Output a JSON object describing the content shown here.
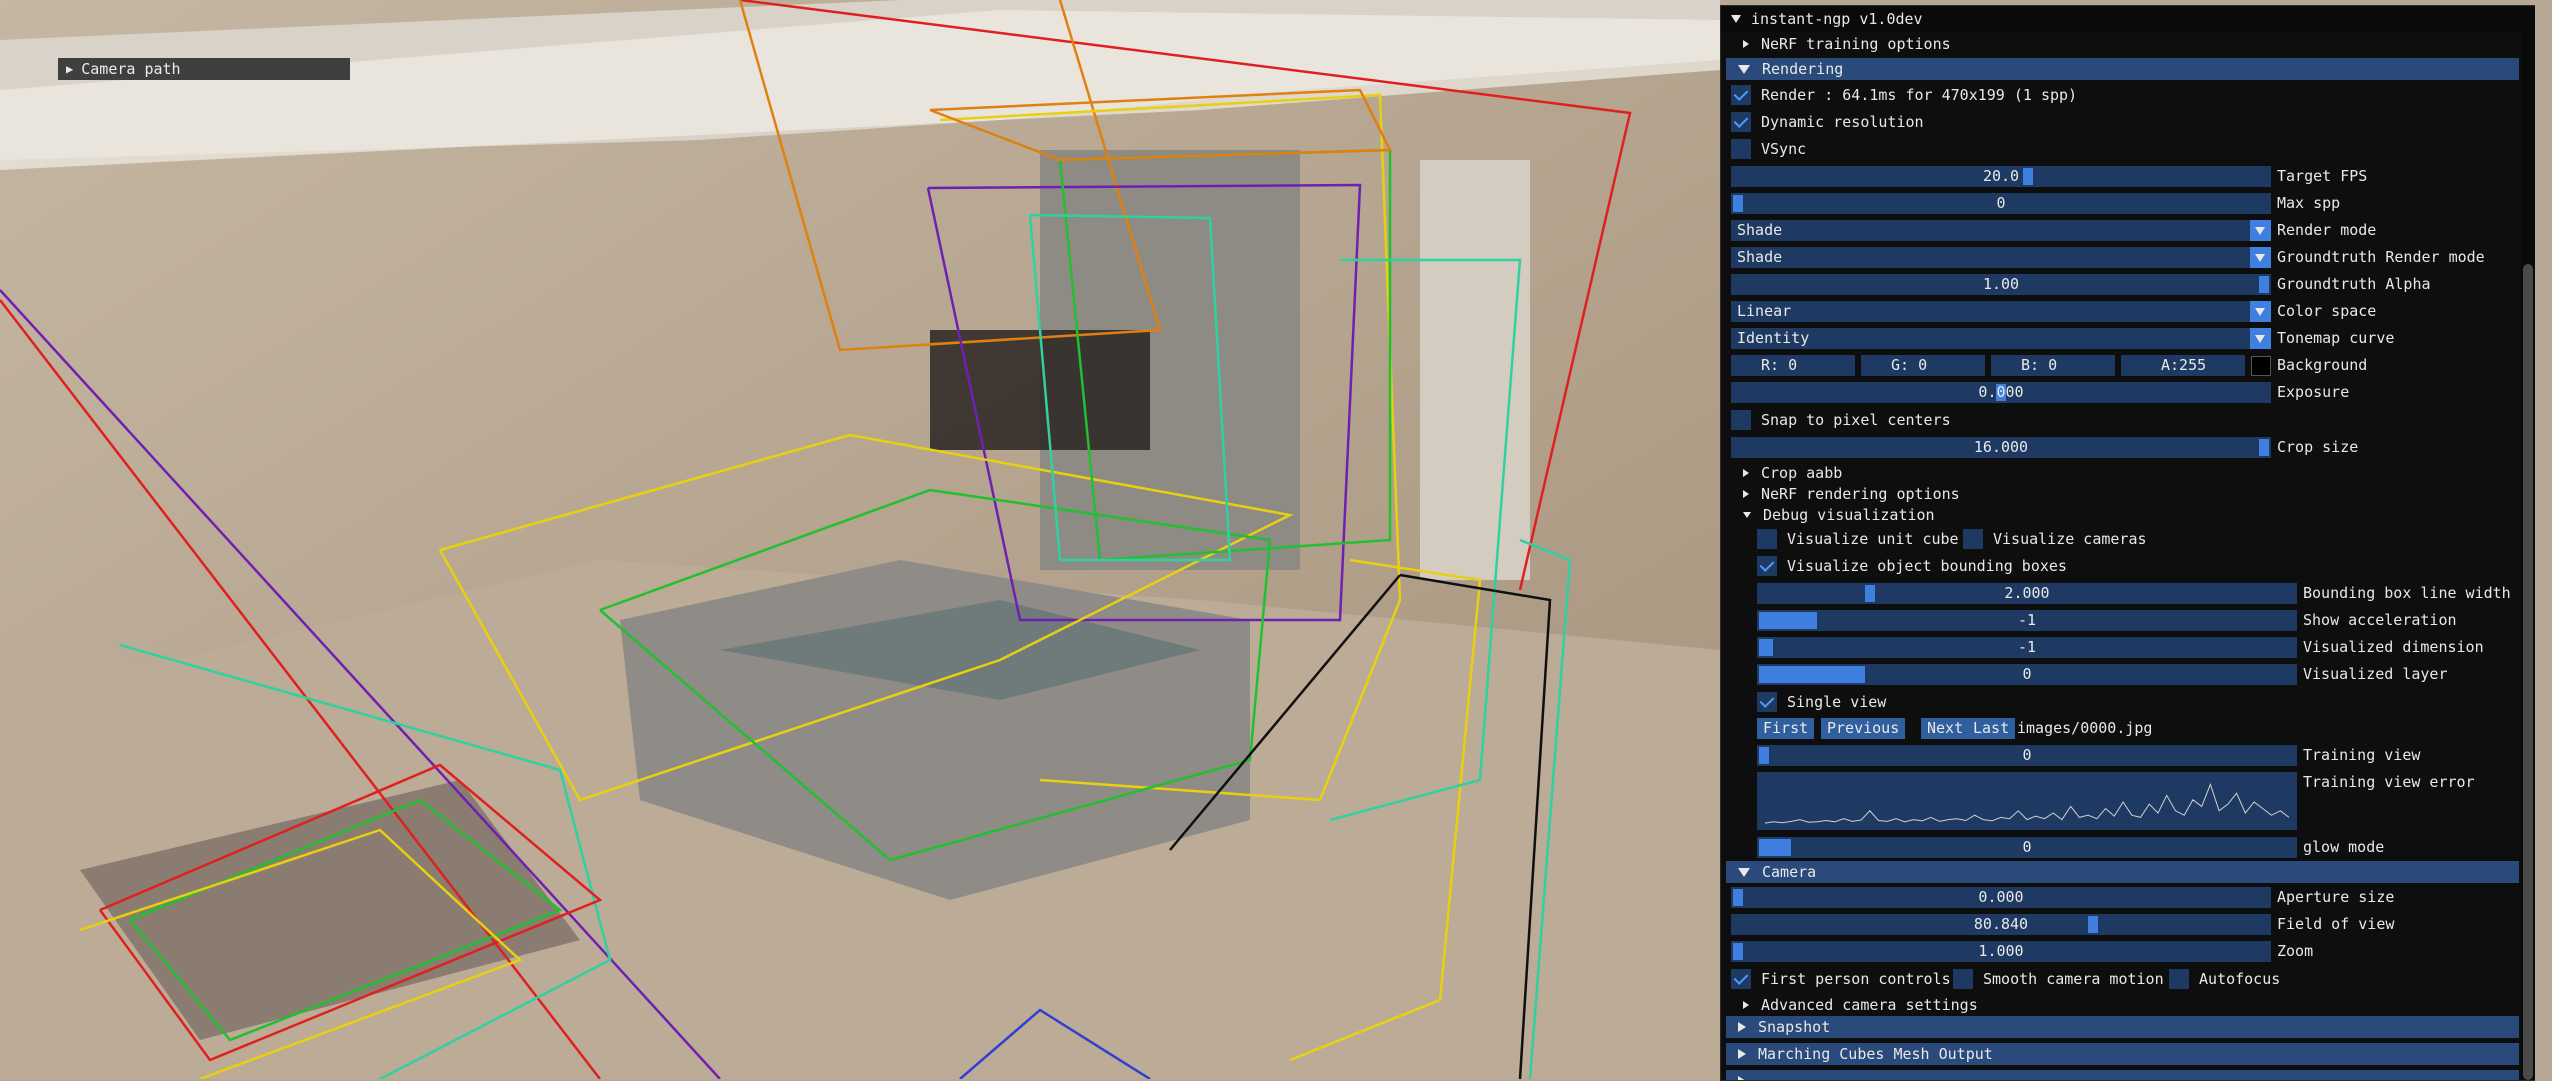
{
  "viewport": {
    "camera_path_label": "Camera path"
  },
  "panel": {
    "title": "instant-ngp v1.0dev",
    "nerf_training_options": "NeRF training options",
    "rendering": {
      "header": "Rendering",
      "render_label": "Render : 64.1ms for 470x199 (1 spp)",
      "render_checked": true,
      "dynamic_resolution": "Dynamic resolution",
      "dynamic_resolution_checked": true,
      "vsync": "VSync",
      "vsync_checked": false,
      "target_fps_value": "20.0",
      "target_fps_label": "Target FPS",
      "max_spp_value": "0",
      "max_spp_label": "Max spp",
      "render_mode_value": "Shade",
      "render_mode_label": "Render mode",
      "gt_render_mode_value": "Shade",
      "gt_render_mode_label": "Groundtruth Render mode",
      "gt_alpha_value": "1.00",
      "gt_alpha_label": "Groundtruth Alpha",
      "color_space_value": "Linear",
      "color_space_label": "Color space",
      "tonemap_value": "Identity",
      "tonemap_label": "Tonemap curve",
      "bg_r": "R:  0",
      "bg_g": "G:  0",
      "bg_b": "B:  0",
      "bg_a": "A:255",
      "background_label": "Background",
      "exposure_value": "0.000",
      "exposure_label": "Exposure",
      "snap_label": "Snap to pixel centers",
      "snap_checked": false,
      "crop_size_value": "16.000",
      "crop_size_label": "Crop size",
      "crop_aabb": "Crop aabb",
      "nerf_rendering_options": "NeRF rendering options",
      "debug_visualization": "Debug visualization",
      "vis_unit_cube": "Visualize unit cube",
      "vis_cameras": "Visualize cameras",
      "vis_bboxes": "Visualize object bounding boxes",
      "vis_bboxes_checked": true,
      "bbox_width_value": "2.000",
      "bbox_width_label": "Bounding box line width",
      "show_accel_value": "-1",
      "show_accel_label": "Show acceleration",
      "vis_dim_value": "-1",
      "vis_dim_label": "Visualized dimension",
      "vis_layer_value": "0",
      "vis_layer_label": "Visualized layer",
      "single_view": "Single view",
      "single_view_checked": true,
      "btn_first": "First",
      "btn_previous": "Previous",
      "btn_next": "Next",
      "btn_last": "Last",
      "image_path": "images/0000.jpg",
      "training_view_value": "0",
      "training_view_label": "Training view",
      "training_view_error_label": "Training view error",
      "glow_mode_value": "0",
      "glow_mode_label": "glow mode"
    },
    "camera": {
      "header": "Camera",
      "aperture_value": "0.000",
      "aperture_label": "Aperture size",
      "fov_value": "80.840",
      "fov_label": "Field of view",
      "zoom_value": "1.000",
      "zoom_label": "Zoom",
      "first_person": "First person controls",
      "first_person_checked": true,
      "smooth_motion": "Smooth camera motion",
      "autofocus": "Autofocus",
      "advanced": "Advanced camera settings"
    },
    "snapshot": "Snapshot",
    "marching_cubes": "Marching Cubes Mesh Output"
  },
  "colors": {
    "panel_bg": "#0e0e0e",
    "header_blue": "#294a7a",
    "widget_blue": "#1f3a62",
    "accent_blue": "#3e7fe0"
  },
  "error_plot": [
    0.02,
    0.05,
    0.03,
    0.06,
    0.1,
    0.04,
    0.05,
    0.08,
    0.05,
    0.12,
    0.06,
    0.09,
    0.3,
    0.08,
    0.06,
    0.12,
    0.05,
    0.1,
    0.07,
    0.15,
    0.06,
    0.1,
    0.12,
    0.08,
    0.2,
    0.1,
    0.07,
    0.15,
    0.12,
    0.3,
    0.1,
    0.18,
    0.12,
    0.25,
    0.1,
    0.4,
    0.15,
    0.2,
    0.12,
    0.35,
    0.18,
    0.5,
    0.2,
    0.15,
    0.45,
    0.25,
    0.65,
    0.3,
    0.2,
    0.55,
    0.4,
    0.9,
    0.3,
    0.45,
    0.7,
    0.25,
    0.5,
    0.35,
    0.2,
    0.3,
    0.15
  ]
}
